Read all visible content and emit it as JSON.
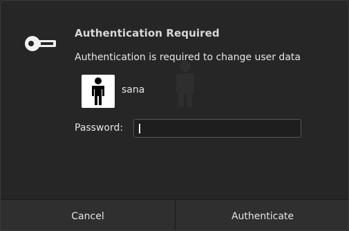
{
  "dialog": {
    "title": "Authentication Required",
    "message": "Authentication is required to change user data",
    "user": {
      "name": "sana",
      "avatar_icon": "person-icon"
    },
    "password": {
      "label": "Password:",
      "value": ""
    },
    "icon": "key-icon",
    "buttons": {
      "cancel": "Cancel",
      "authenticate": "Authenticate"
    }
  },
  "colors": {
    "dialog_background": "#262626",
    "text": "#e6e6e6",
    "title_text": "#d8d8d8",
    "button_bar": "#2f2f2f"
  }
}
